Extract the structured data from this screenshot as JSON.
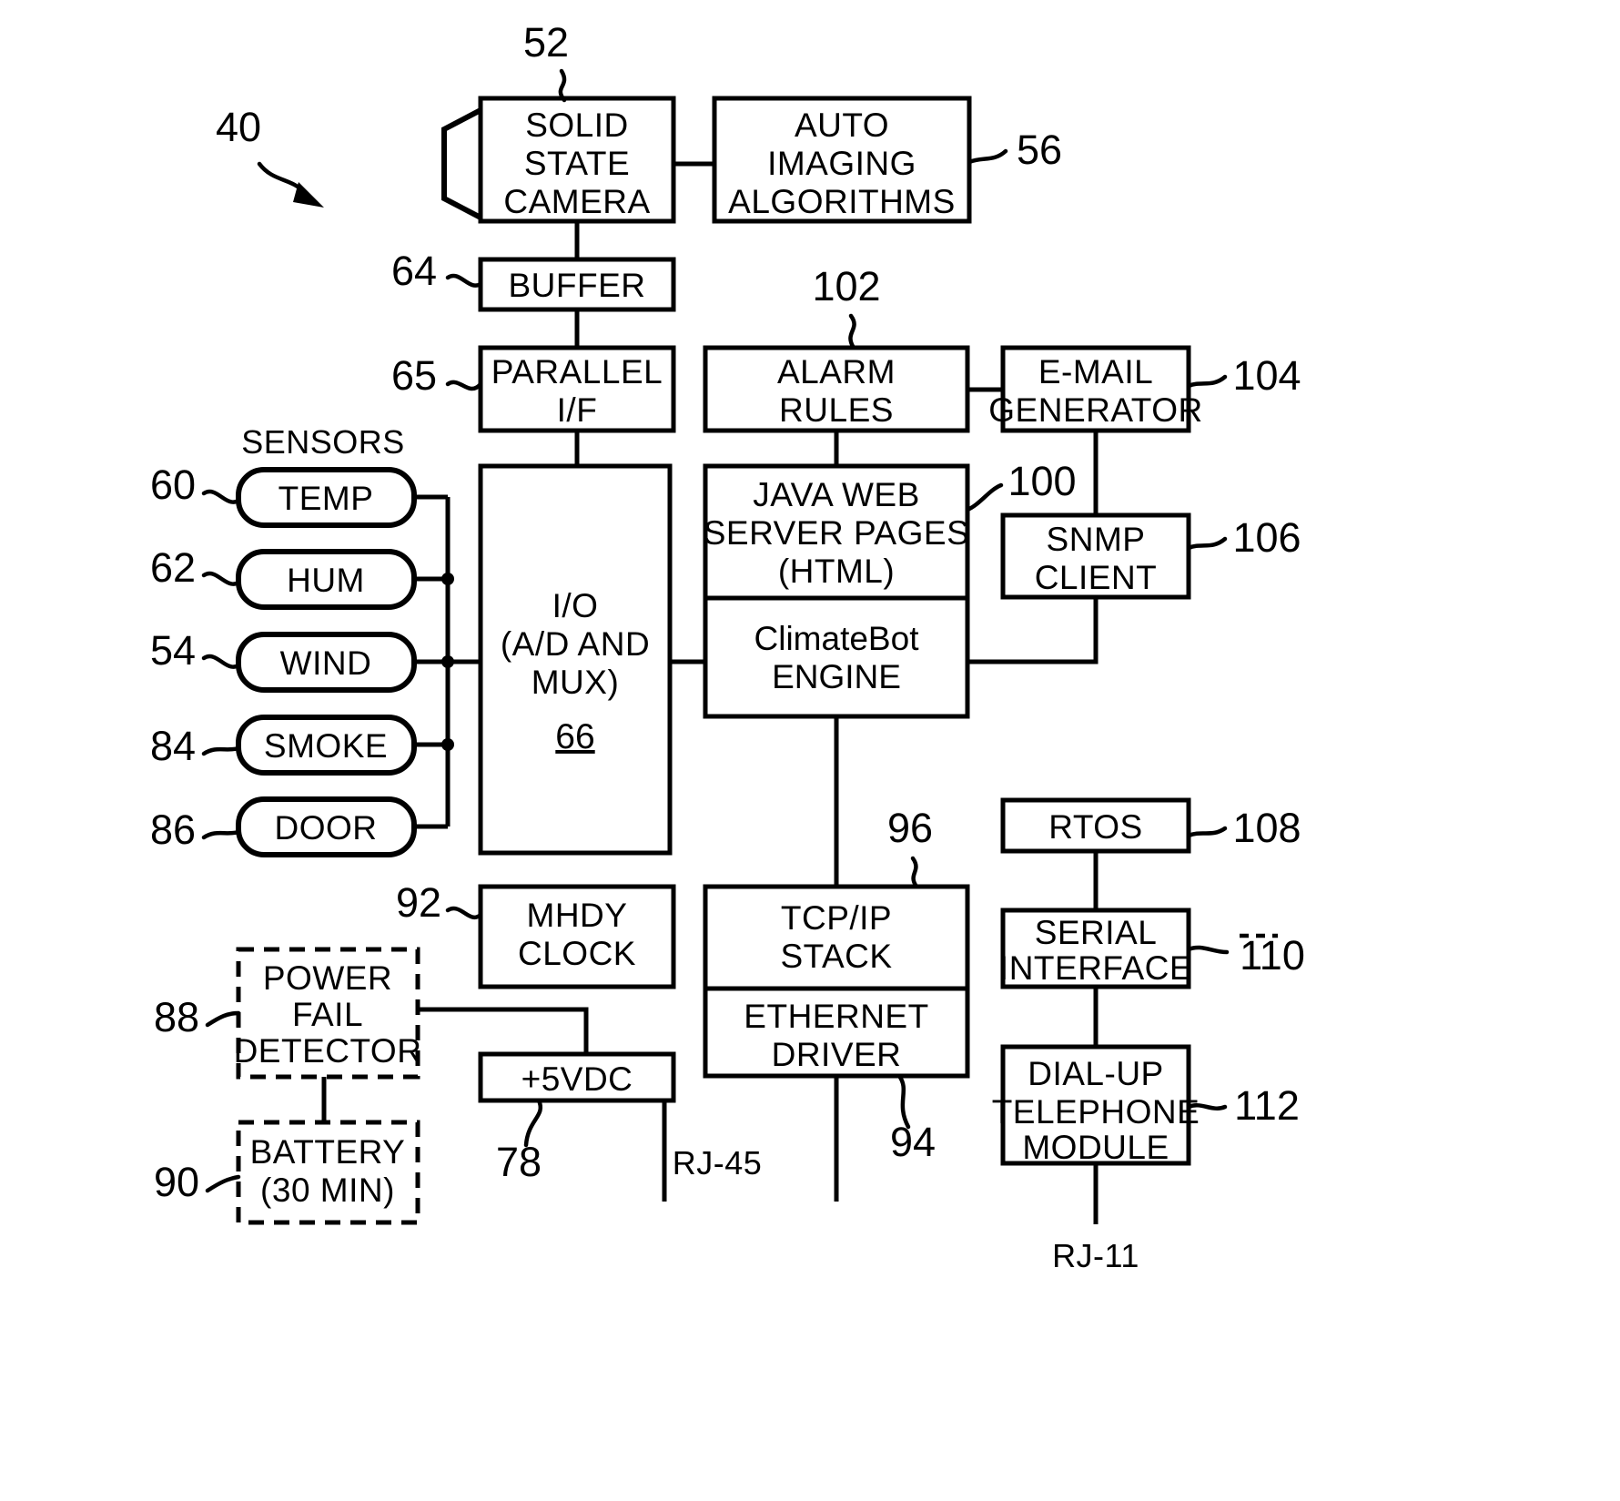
{
  "figure": {
    "overall_ref": "40",
    "labels": {
      "sensors_heading": "SENSORS",
      "rj45": "RJ-45",
      "rj11": "RJ-11"
    }
  },
  "blocks": {
    "solid_state_camera": {
      "ref": "52",
      "lines": [
        "SOLID",
        "STATE",
        "CAMERA"
      ]
    },
    "auto_imaging": {
      "ref": "56",
      "lines": [
        "AUTO",
        "IMAGING",
        "ALGORITHMS"
      ]
    },
    "buffer": {
      "ref": "64",
      "lines": [
        "BUFFER"
      ]
    },
    "parallel_if": {
      "ref": "65",
      "lines": [
        "PARALLEL",
        "I/F"
      ]
    },
    "io_mux": {
      "ref": "66",
      "lines": [
        "I/O",
        "(A/D  AND",
        "MUX)"
      ]
    },
    "alarm_rules": {
      "ref": "102",
      "lines": [
        "ALARM",
        "RULES"
      ]
    },
    "email_generator": {
      "ref": "104",
      "lines": [
        "E-MAIL",
        "GENERATOR"
      ]
    },
    "java_web_server_pages": {
      "ref": "100",
      "lines": [
        "JAVA WEB",
        "SERVER  PAGES",
        "(HTML)"
      ]
    },
    "climatebot_engine": {
      "lines": [
        "ClimateBot",
        "ENGINE"
      ]
    },
    "snmp_client": {
      "ref": "106",
      "lines": [
        "SNMP",
        "CLIENT"
      ]
    },
    "rtos": {
      "ref": "108",
      "lines": [
        "RTOS"
      ]
    },
    "serial_interface": {
      "ref": "110",
      "lines": [
        "SERIAL",
        "INTERFACE"
      ]
    },
    "dialup_telephone_module": {
      "ref": "112",
      "lines": [
        "DIAL-UP",
        "TELEPHONE",
        "MODULE"
      ]
    },
    "tcpip_stack": {
      "ref": "96",
      "lines": [
        "TCP/IP",
        "STACK"
      ]
    },
    "ethernet_driver": {
      "ref": "94",
      "lines": [
        "ETHERNET",
        "DRIVER"
      ]
    },
    "mhdy_clock": {
      "ref": "92",
      "lines": [
        "MHDY",
        "CLOCK"
      ]
    },
    "power_supply": {
      "ref": "78",
      "lines": [
        "+5VDC"
      ]
    },
    "power_fail_detector": {
      "ref": "88",
      "lines": [
        "POWER",
        "FAIL",
        "DETECTOR"
      ]
    },
    "battery": {
      "ref": "90",
      "lines": [
        "BATTERY",
        "(30  MIN)"
      ]
    }
  },
  "sensors": [
    {
      "ref": "60",
      "label": "TEMP"
    },
    {
      "ref": "62",
      "label": "HUM"
    },
    {
      "ref": "54",
      "label": "WIND"
    },
    {
      "ref": "84",
      "label": "SMOKE"
    },
    {
      "ref": "86",
      "label": "DOOR"
    }
  ],
  "colors": {
    "ink": "#000000",
    "paper": "#ffffff"
  }
}
